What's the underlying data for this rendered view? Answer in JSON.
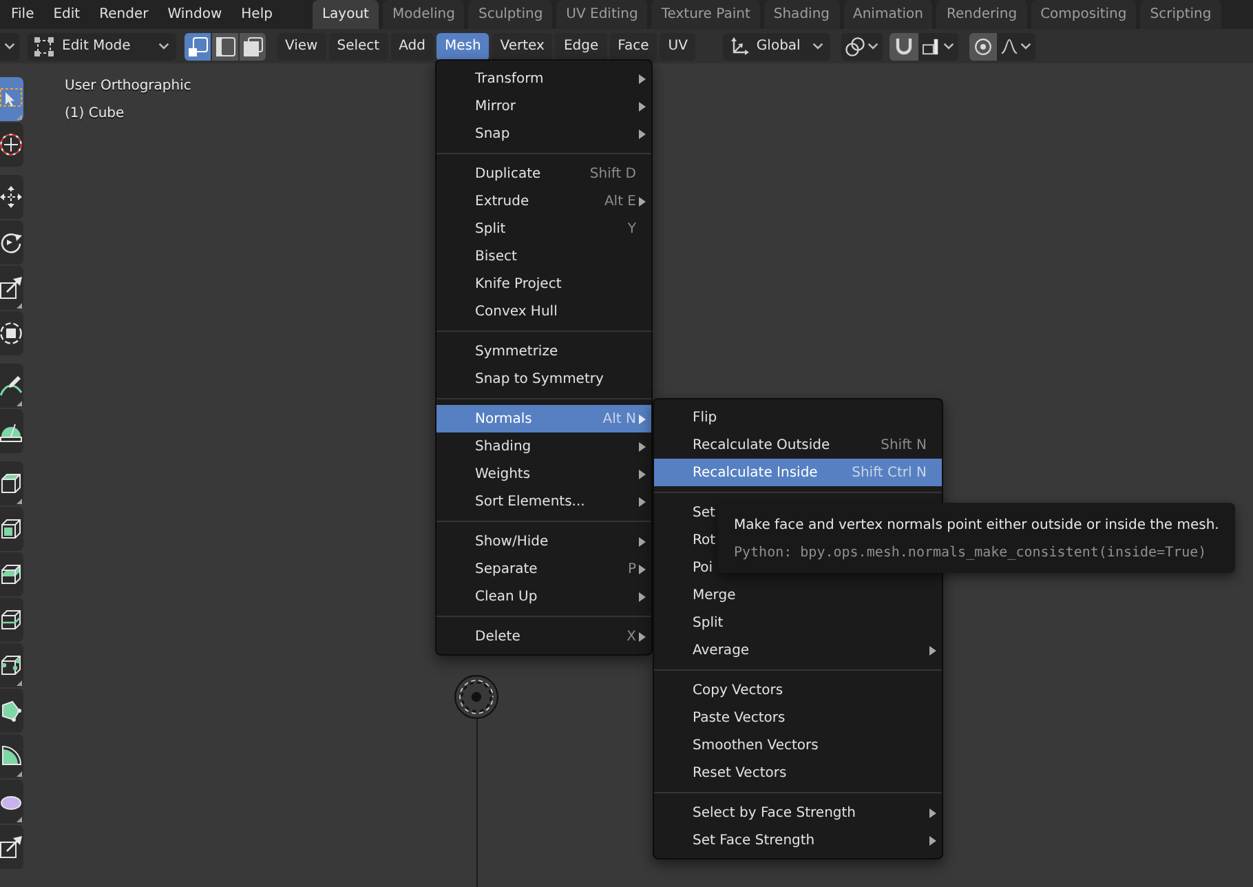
{
  "menubar": [
    "File",
    "Edit",
    "Render",
    "Window",
    "Help"
  ],
  "workspace_tabs": [
    {
      "label": "Layout",
      "selected": true
    },
    {
      "label": "Modeling",
      "selected": false
    },
    {
      "label": "Sculpting",
      "selected": false
    },
    {
      "label": "UV Editing",
      "selected": false
    },
    {
      "label": "Texture Paint",
      "selected": false
    },
    {
      "label": "Shading",
      "selected": false
    },
    {
      "label": "Animation",
      "selected": false
    },
    {
      "label": "Rendering",
      "selected": false
    },
    {
      "label": "Compositing",
      "selected": false
    },
    {
      "label": "Scripting",
      "selected": false
    }
  ],
  "header": {
    "mode": "Edit Mode",
    "select_modes": [
      {
        "kind": "vertex",
        "selected": true
      },
      {
        "kind": "edge",
        "selected": false
      },
      {
        "kind": "face",
        "selected": false
      }
    ],
    "menus": [
      {
        "label": "View",
        "selected": false
      },
      {
        "label": "Select",
        "selected": false
      },
      {
        "label": "Add",
        "selected": false
      },
      {
        "label": "Mesh",
        "selected": true
      },
      {
        "label": "Vertex",
        "selected": false
      },
      {
        "label": "Edge",
        "selected": false
      },
      {
        "label": "Face",
        "selected": false
      },
      {
        "label": "UV",
        "selected": false
      }
    ],
    "orientation": "Global",
    "snap_on": false,
    "proportional_on": false
  },
  "toolbar": [
    {
      "tools": [
        {
          "kind": "select-box",
          "selected": true,
          "more": true
        },
        {
          "kind": "cursor",
          "selected": false,
          "more": false
        }
      ]
    },
    {
      "tools": [
        {
          "kind": "move",
          "selected": false,
          "more": false
        },
        {
          "kind": "rotate",
          "selected": false,
          "more": false
        },
        {
          "kind": "scale",
          "selected": false,
          "more": true
        },
        {
          "kind": "transform",
          "selected": false,
          "more": false
        }
      ]
    },
    {
      "tools": [
        {
          "kind": "annotate",
          "selected": false,
          "more": true
        },
        {
          "kind": "measure",
          "selected": false,
          "more": false
        }
      ]
    },
    {
      "tools": [
        {
          "kind": "extrude",
          "selected": false,
          "more": true
        },
        {
          "kind": "inset",
          "selected": false,
          "more": false
        },
        {
          "kind": "bevel",
          "selected": false,
          "more": false
        },
        {
          "kind": "loop-cut",
          "selected": false,
          "more": false
        },
        {
          "kind": "knife",
          "selected": false,
          "more": true
        },
        {
          "kind": "poly-build",
          "selected": false,
          "more": false
        },
        {
          "kind": "spin",
          "selected": false,
          "more": true
        },
        {
          "kind": "smooth",
          "selected": false,
          "more": true
        },
        {
          "kind": "shrink",
          "selected": false,
          "more": false
        }
      ]
    }
  ],
  "viewport": {
    "view_name": "User Orthographic",
    "object_name": "(1) Cube"
  },
  "mesh_menu": {
    "sections": [
      {
        "items": [
          {
            "label": "Transform",
            "submenu": true,
            "selected": false
          },
          {
            "label": "Mirror",
            "submenu": true,
            "selected": false
          },
          {
            "label": "Snap",
            "submenu": true,
            "selected": false
          }
        ]
      },
      {
        "items": [
          {
            "label": "Duplicate",
            "shortcut": "Shift D",
            "submenu": false,
            "selected": false
          },
          {
            "label": "Extrude",
            "shortcut": "Alt E",
            "submenu": true,
            "selected": false
          },
          {
            "label": "Split",
            "shortcut": "Y",
            "submenu": false,
            "selected": false
          },
          {
            "label": "Bisect",
            "submenu": false,
            "selected": false
          },
          {
            "label": "Knife Project",
            "submenu": false,
            "selected": false
          },
          {
            "label": "Convex Hull",
            "submenu": false,
            "selected": false
          }
        ]
      },
      {
        "items": [
          {
            "label": "Symmetrize",
            "submenu": false,
            "selected": false
          },
          {
            "label": "Snap to Symmetry",
            "submenu": false,
            "selected": false
          }
        ]
      },
      {
        "items": [
          {
            "label": "Normals",
            "shortcut": "Alt N",
            "submenu": true,
            "selected": true
          },
          {
            "label": "Shading",
            "submenu": true,
            "selected": false
          },
          {
            "label": "Weights",
            "submenu": true,
            "selected": false
          },
          {
            "label": "Sort Elements...",
            "submenu": true,
            "selected": false
          }
        ]
      },
      {
        "items": [
          {
            "label": "Show/Hide",
            "submenu": true,
            "selected": false
          },
          {
            "label": "Separate",
            "shortcut": "P",
            "submenu": true,
            "selected": false
          },
          {
            "label": "Clean Up",
            "submenu": true,
            "selected": false
          }
        ]
      },
      {
        "items": [
          {
            "label": "Delete",
            "shortcut": "X",
            "submenu": true,
            "selected": false
          }
        ]
      }
    ]
  },
  "normals_submenu": {
    "sections": [
      {
        "items": [
          {
            "label": "Flip",
            "submenu": false,
            "selected": false
          },
          {
            "label": "Recalculate Outside",
            "shortcut": "Shift N",
            "submenu": false,
            "selected": false
          },
          {
            "label": "Recalculate Inside",
            "shortcut": "Shift Ctrl N",
            "submenu": false,
            "selected": true
          }
        ]
      },
      {
        "items": [
          {
            "label": "Set",
            "submenu": false,
            "selected": false
          },
          {
            "label": "Rot",
            "submenu": false,
            "selected": false
          },
          {
            "label": "Poi",
            "submenu": false,
            "selected": false
          },
          {
            "label": "Merge",
            "submenu": false,
            "selected": false
          },
          {
            "label": "Split",
            "submenu": false,
            "selected": false
          },
          {
            "label": "Average",
            "submenu": true,
            "selected": false
          }
        ]
      },
      {
        "items": [
          {
            "label": "Copy Vectors",
            "submenu": false,
            "selected": false
          },
          {
            "label": "Paste Vectors",
            "submenu": false,
            "selected": false
          },
          {
            "label": "Smoothen Vectors",
            "submenu": false,
            "selected": false
          },
          {
            "label": "Reset Vectors",
            "submenu": false,
            "selected": false
          }
        ]
      },
      {
        "items": [
          {
            "label": "Select by Face Strength",
            "submenu": true,
            "selected": false
          },
          {
            "label": "Set Face Strength",
            "submenu": true,
            "selected": false
          }
        ]
      }
    ]
  },
  "tooltip": {
    "description": "Make face and vertex normals point either outside or inside the mesh.",
    "python": "Python: bpy.ops.mesh.normals_make_consistent(inside=True)"
  }
}
